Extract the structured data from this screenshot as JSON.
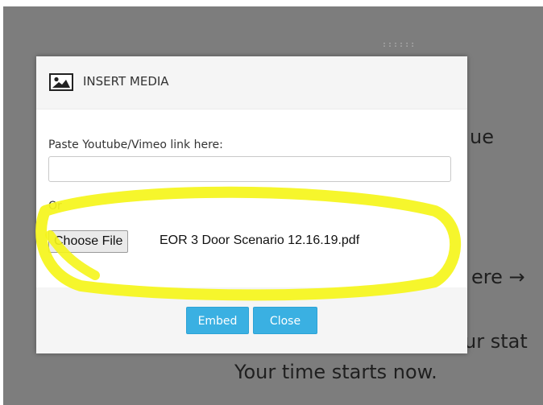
{
  "background": {
    "text_lines": [
      "ue",
      "ere →",
      "ur stat",
      "Your time starts now."
    ]
  },
  "dialog": {
    "title": "INSERT MEDIA",
    "icon": "image-icon",
    "link_label": "Paste Youtube/Vimeo link here:",
    "link_value": "",
    "or_label": "Or",
    "choose_file_label": "Choose File",
    "file_name": "EOR 3 Door Scenario 12.16.19.pdf",
    "embed_label": "Embed",
    "close_label": "Close"
  },
  "colors": {
    "overlay": "#7d7d7d",
    "button": "#3ab0e2",
    "highlight": "#f5f51a"
  }
}
